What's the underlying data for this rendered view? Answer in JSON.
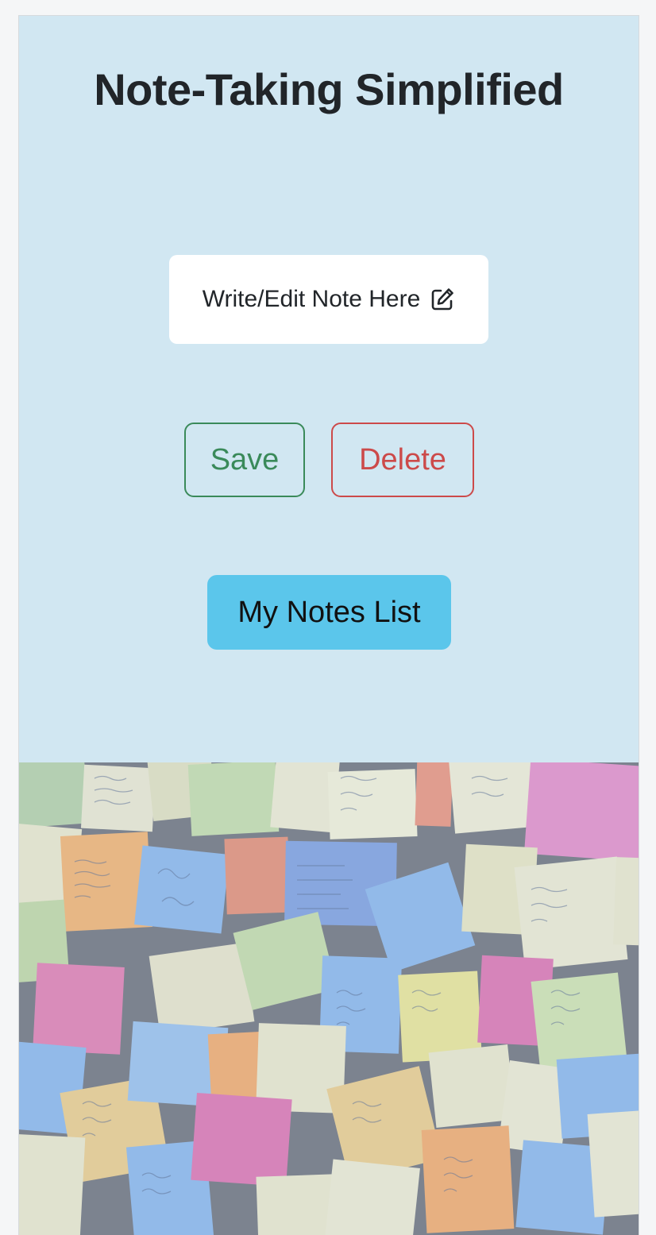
{
  "header": {
    "title": "Note-Taking Simplified"
  },
  "note_card": {
    "label": "Write/Edit Note Here",
    "icon": "pencil-square-icon"
  },
  "actions": {
    "save_label": "Save",
    "delete_label": "Delete",
    "list_label": "My Notes List"
  },
  "colors": {
    "panel_background": "#d1e7f2",
    "save": "#3a8a5a",
    "delete": "#cc4a4a",
    "list_button": "#5bc6eb"
  },
  "hero_image": {
    "description_icon": "sticky-notes-wall-image"
  }
}
